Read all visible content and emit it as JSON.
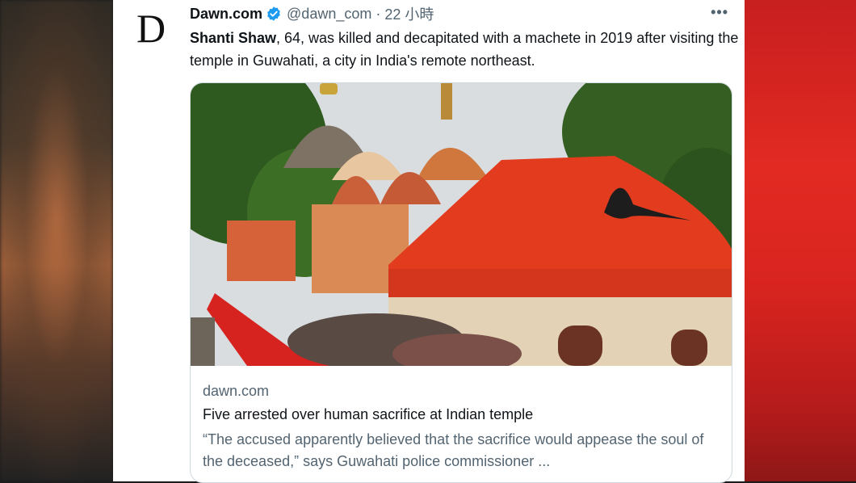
{
  "tweet": {
    "avatar_letter": "D",
    "author_name": "Dawn.com",
    "handle": "@dawn_com",
    "separator": "·",
    "time": "22 小時",
    "more_icon": "more-icon",
    "verified_color": "#1d9bf0",
    "text_bold": "Shanti Shaw",
    "text_rest": ", 64, was killed and decapitated with a machete in 2019 after visiting the temple in Guwahati, a city in India's remote northeast."
  },
  "card": {
    "domain": "dawn.com",
    "title": "Five arrested over human sacrifice at Indian temple",
    "description": "“The accused apparently believed that the sacrifice would appease the soul of the deceased,” says Guwahati police commissioner ..."
  }
}
